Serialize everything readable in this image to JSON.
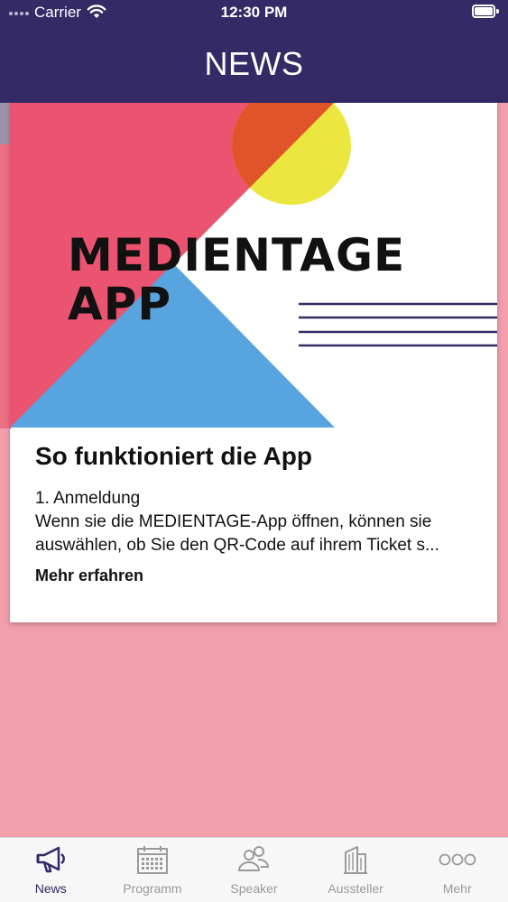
{
  "status_bar": {
    "carrier": "Carrier",
    "time": "12:30 PM"
  },
  "nav": {
    "title": "NEWS"
  },
  "card": {
    "hero_text_line1": "MEDIENTAGE",
    "hero_text_line2": "APP",
    "title": "So funktioniert die App",
    "body_line1": "1. Anmeldung",
    "body_line2": "Wenn sie die MEDIENTAGE-App öffnen, können sie",
    "body_line3": "auswählen, ob Sie den QR-Code auf ihrem Ticket s...",
    "link_label": "Mehr erfahren"
  },
  "tabs": [
    {
      "label": "News",
      "icon": "megaphone-icon",
      "active": true
    },
    {
      "label": "Programm",
      "icon": "calendar-icon",
      "active": false
    },
    {
      "label": "Speaker",
      "icon": "people-icon",
      "active": false
    },
    {
      "label": "Aussteller",
      "icon": "building-icon",
      "active": false
    },
    {
      "label": "Mehr",
      "icon": "more-dots-icon",
      "active": false
    }
  ],
  "colors": {
    "header": "#332a66",
    "background": "#f19fac",
    "hero_pink": "#ea5470",
    "hero_blue": "#58a4df",
    "hero_orange": "#e0542a",
    "hero_yellow": "#ece640",
    "active_tab": "#332a66",
    "inactive_tab": "#9a9a9a"
  }
}
